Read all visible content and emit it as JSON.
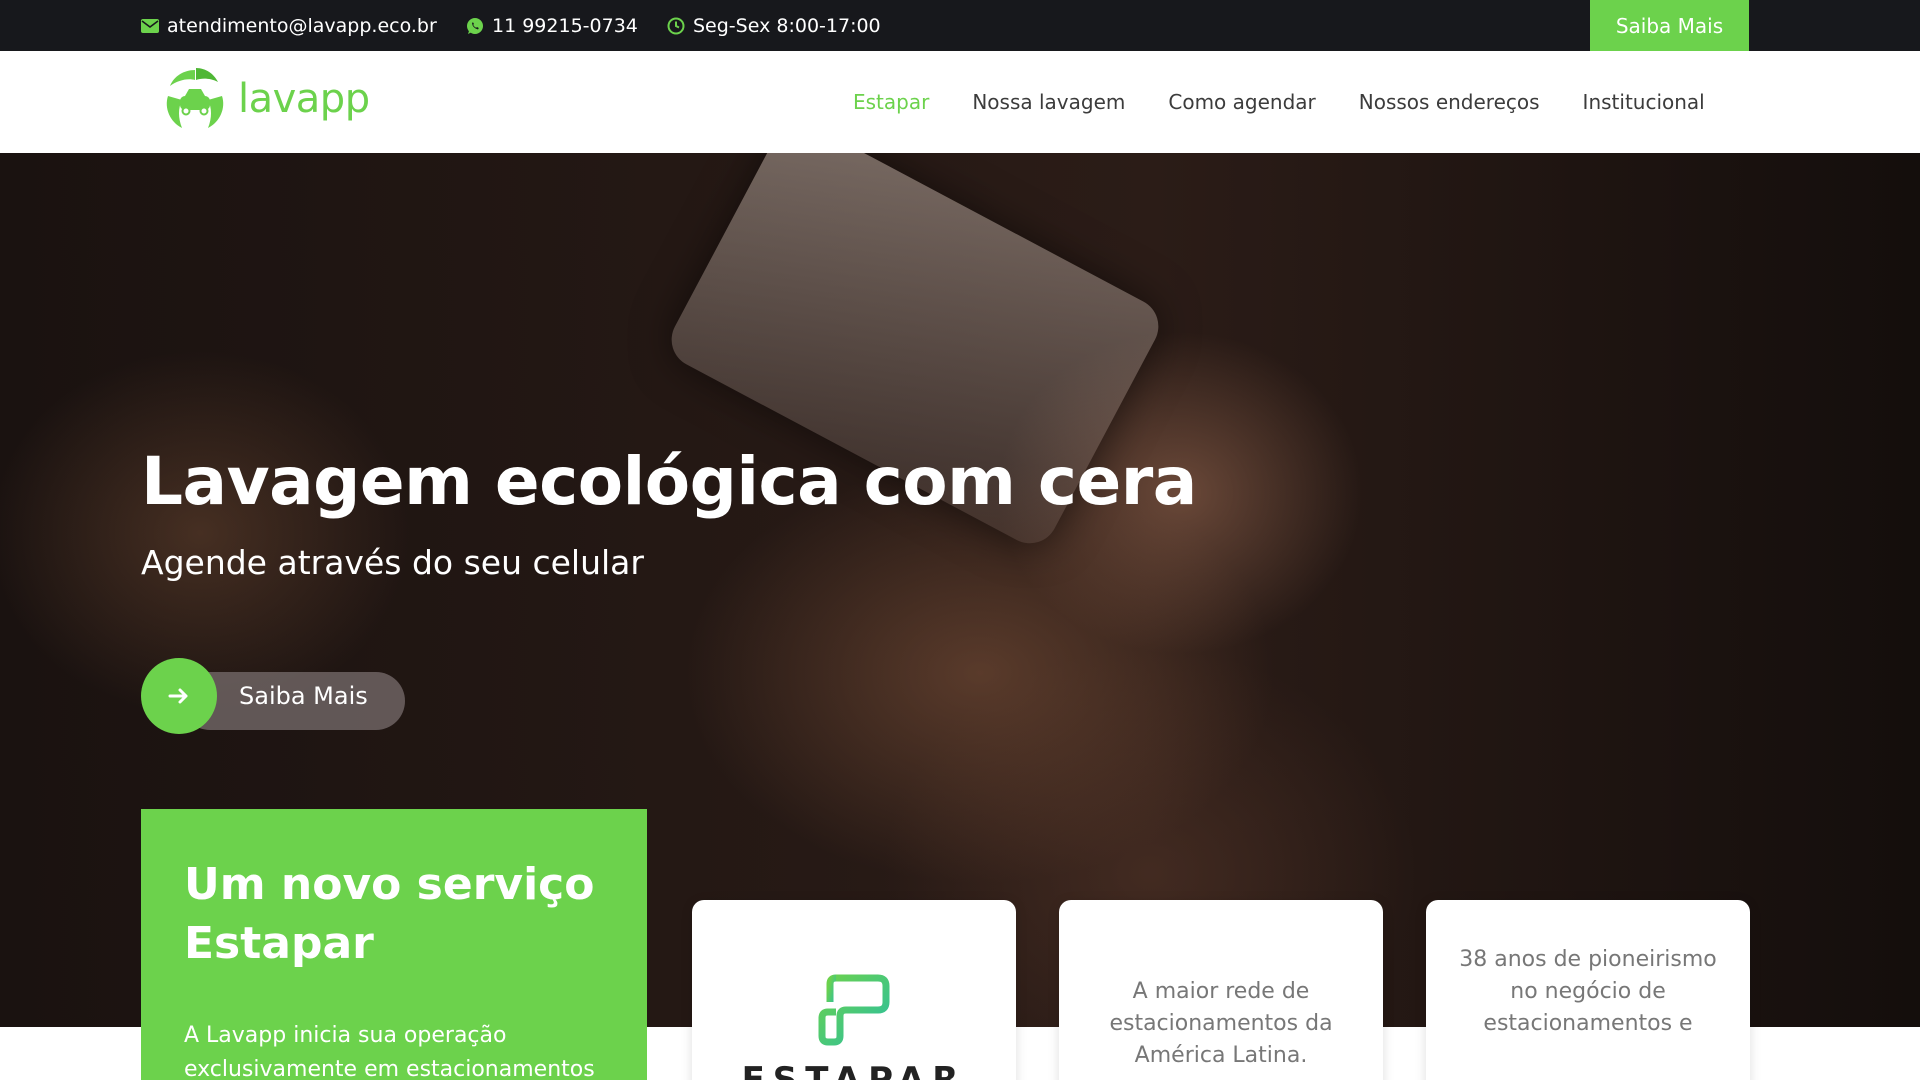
{
  "topbar": {
    "email": "atendimento@lavapp.eco.br",
    "phone": "11 99215-0734",
    "hours": "Seg-Sex 8:00-17:00",
    "cta_label": "Saiba Mais",
    "icons": [
      "envelope-icon",
      "whatsapp-icon",
      "clock-icon"
    ]
  },
  "header": {
    "logo_text": "lavapp",
    "nav": [
      {
        "label": "Estapar",
        "active": true
      },
      {
        "label": "Nossa lavagem",
        "active": false
      },
      {
        "label": "Como agendar",
        "active": false
      },
      {
        "label": "Nossos endereços",
        "active": false
      },
      {
        "label": "Institucional",
        "active": false
      }
    ]
  },
  "hero": {
    "title": "Lavagem ecológica com cera",
    "subtitle": "Agende através do seu celular",
    "button_label": "Saiba Mais"
  },
  "feature": {
    "title_line1": "Um novo serviço",
    "title_line2": "Estapar",
    "text": "A Lavapp inicia sua operação exclusivamente em estacionamentos"
  },
  "cards": {
    "estapar_wordmark": "ESTAPAR",
    "card2_text": "A maior rede de estacionamentos da América Latina.",
    "card3_text": "38 anos de pioneirismo no negócio de estacionamentos e"
  },
  "colors": {
    "accent": "#6cd24c",
    "topbar_bg": "#17181c",
    "nav_text": "#3c3c3c",
    "card_text": "#777777"
  }
}
